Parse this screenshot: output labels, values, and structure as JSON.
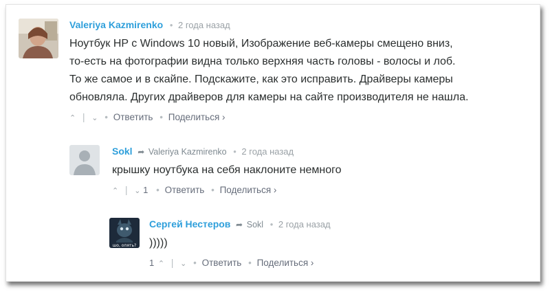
{
  "comments": [
    {
      "author": "Valeriya Kazmirenko",
      "reply_to": "",
      "time": "2 года назад",
      "lines": [
        "Ноутбук HP с Windows 10 новый, Изображение веб-камеры смещено вниз,",
        "то-есть на фотографии видна только верхняя часть головы - волосы и лоб.",
        "То же самое и в скайпе. Подскажите, как это исправить. Драйверы камеры",
        "обновляла. Других драйверов для камеры на сайте производителя не нашла."
      ],
      "upvotes": "",
      "downvotes": "",
      "reply_label": "Ответить",
      "share_label": "Поделиться ›"
    },
    {
      "author": "Sokl",
      "reply_to": "Valeriya Kazmirenko",
      "time": "2 года назад",
      "lines": [
        "крышку ноутбука на себя наклоните немного"
      ],
      "upvotes": "",
      "downvotes": "1",
      "reply_label": "Ответить",
      "share_label": "Поделиться ›"
    },
    {
      "author": "Сергей Нестеров",
      "reply_to": "Sokl",
      "time": "2 года назад",
      "lines": [
        ")))))"
      ],
      "avatar_caption": "шо, опять?",
      "upvotes": "1",
      "downvotes": "",
      "reply_label": "Ответить",
      "share_label": "Поделиться ›"
    }
  ],
  "colors": {
    "author": "#2e9fdb",
    "text": "#2a2e2e",
    "meta": "#9aa1a6",
    "action": "#656c7a"
  }
}
